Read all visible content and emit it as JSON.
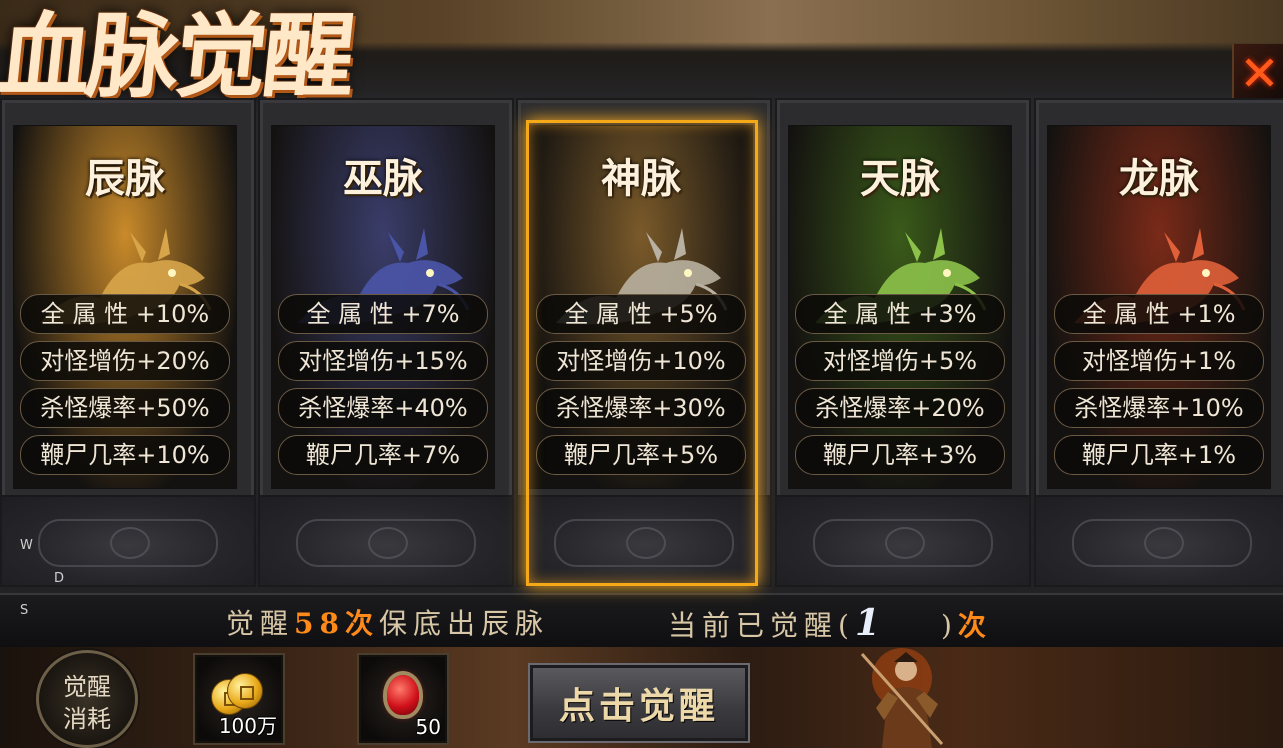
{
  "title": "血脉觉醒",
  "close_icon": "close-icon",
  "cards": [
    {
      "name": "辰脉",
      "tone": "#c98a2a",
      "dragon": "#d7a54a",
      "stats": [
        "全 属 性 +10%",
        "对怪增伤+20%",
        "杀怪爆率+50%",
        "鞭尸几率+10%"
      ]
    },
    {
      "name": "巫脉",
      "tone": "#3a3d6a",
      "dragon": "#4a55a8",
      "stats": [
        "全 属 性 +7%",
        "对怪增伤+15%",
        "杀怪爆率+40%",
        "鞭尸几率+7%"
      ]
    },
    {
      "name": "神脉",
      "tone": "#7a5a2a",
      "dragon": "#b8b0a0",
      "stats": [
        "全 属 性 +5%",
        "对怪增伤+10%",
        "杀怪爆率+30%",
        "鞭尸几率+5%"
      ]
    },
    {
      "name": "天脉",
      "tone": "#3a5a1a",
      "dragon": "#8cc24a",
      "stats": [
        "全 属 性 +3%",
        "对怪增伤+5%",
        "杀怪爆率+20%",
        "鞭尸几率+3%"
      ]
    },
    {
      "name": "龙脉",
      "tone": "#7a2a18",
      "dragon": "#e0603a",
      "stats": [
        "全 属 性 +1%",
        "对怪增伤+1%",
        "杀怪爆率+10%",
        "鞭尸几率+1%"
      ]
    }
  ],
  "selected_card": "神脉",
  "counter": {
    "guarantee_prefix": "觉醒",
    "guarantee_number": "58",
    "guarantee_suffix_hl": "次",
    "guarantee_rest": "保底出辰脉",
    "current_prefix": "当前已觉醒(",
    "current_value": "1",
    "current_suffix": ")",
    "current_unit": "次"
  },
  "side_letters": [
    "W",
    "D",
    "S"
  ],
  "cost": {
    "badge_line1": "觉醒",
    "badge_line2": "消耗",
    "items": [
      {
        "icon": "gold-coin-icon",
        "amount": "100万"
      },
      {
        "icon": "red-gem-icon",
        "amount": "50"
      }
    ]
  },
  "awaken_button": "点击觉醒"
}
